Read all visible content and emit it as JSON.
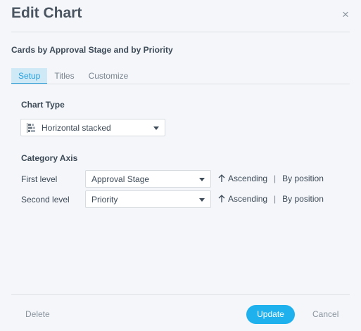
{
  "dialog": {
    "title": "Edit Chart",
    "close_glyph": "×",
    "subtitle": "Cards by Approval Stage and by Priority"
  },
  "tabs": [
    {
      "label": "Setup",
      "active": true
    },
    {
      "label": "Titles",
      "active": false
    },
    {
      "label": "Customize",
      "active": false
    }
  ],
  "setup": {
    "chart_type_label": "Chart Type",
    "chart_type_value": "Horizontal stacked",
    "chart_type_icon": "horizontal-stacked-bar-icon",
    "category_axis_label": "Category Axis",
    "levels": [
      {
        "label": "First level",
        "value": "Approval Stage",
        "sort_direction": "Ascending",
        "sort_by": "By position"
      },
      {
        "label": "Second level",
        "value": "Priority",
        "sort_direction": "Ascending",
        "sort_by": "By position"
      }
    ]
  },
  "footer": {
    "delete_label": "Delete",
    "update_label": "Update",
    "cancel_label": "Cancel"
  },
  "colors": {
    "accent": "#2b9fd9",
    "primary_button": "#1fb1ee",
    "active_tab_bg": "#cfe9f7"
  }
}
